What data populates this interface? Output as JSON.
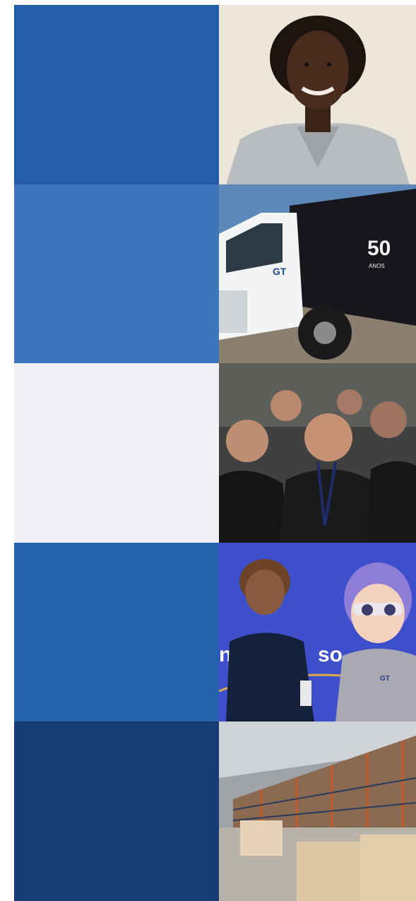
{
  "rows": [
    {
      "panel_color": "#245DA8",
      "photo": "portrait-woman-photo"
    },
    {
      "panel_color": "#3F76BB",
      "photo": "delivery-truck-photo"
    },
    {
      "panel_color": "#EFF1F5",
      "photo": "team-event-photo"
    },
    {
      "panel_color": "#2762AC",
      "photo": "employee-mascot-photo"
    },
    {
      "panel_color": "#163C74",
      "photo": "warehouse-photo"
    }
  ],
  "truck": {
    "logo": "GT",
    "badge": "50",
    "badge_sub": "ANOS"
  },
  "mascot": {
    "banner_text": "so",
    "banner_text_left": "n",
    "logo": "GT"
  }
}
